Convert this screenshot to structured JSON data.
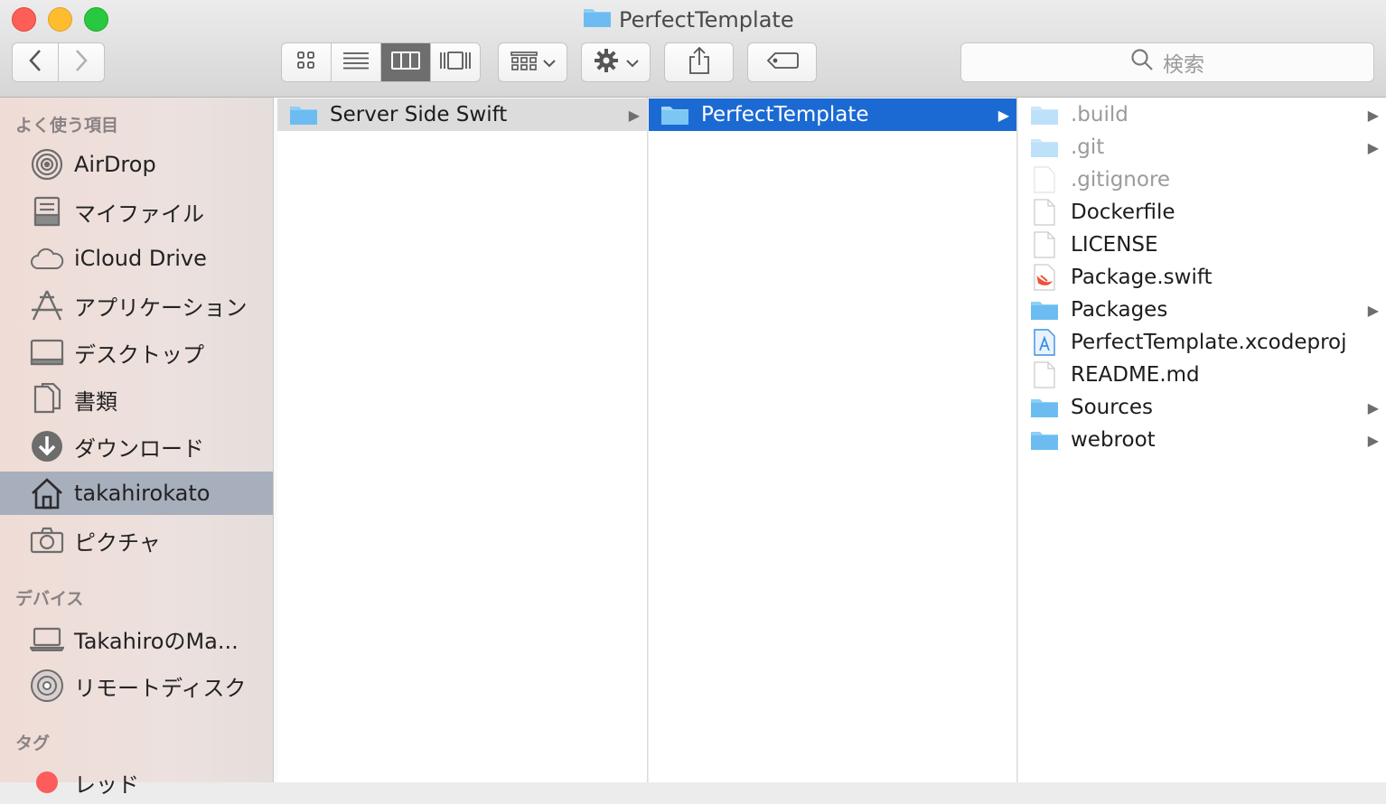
{
  "window": {
    "title": "PerfectTemplate"
  },
  "toolbar": {
    "back_icon": "chevron-left-icon",
    "forward_icon": "chevron-right-icon",
    "view_modes": [
      "icon-view-icon",
      "list-view-icon",
      "column-view-icon",
      "gallery-view-icon"
    ],
    "active_view": "column",
    "arrange_icon": "arrange-icon",
    "action_icon": "gear-icon",
    "share_icon": "share-icon",
    "tag_icon": "tag-icon",
    "search_placeholder": "検索"
  },
  "sidebar": {
    "favorites_header": "よく使う項目",
    "favorites": [
      {
        "label": "AirDrop",
        "icon": "airdrop-icon"
      },
      {
        "label": "マイファイル",
        "icon": "all-files-icon"
      },
      {
        "label": "iCloud Drive",
        "icon": "cloud-icon"
      },
      {
        "label": "アプリケーション",
        "icon": "applications-icon"
      },
      {
        "label": "デスクトップ",
        "icon": "desktop-icon"
      },
      {
        "label": "書類",
        "icon": "documents-icon"
      },
      {
        "label": "ダウンロード",
        "icon": "download-icon"
      },
      {
        "label": "takahirokato",
        "icon": "home-icon",
        "selected": true
      },
      {
        "label": "ピクチャ",
        "icon": "camera-icon"
      }
    ],
    "devices_header": "デバイス",
    "devices": [
      {
        "label": "TakahiroのMa...",
        "icon": "laptop-icon"
      },
      {
        "label": "リモートディスク",
        "icon": "disc-icon"
      }
    ],
    "tags_header": "タグ",
    "tags": [
      {
        "label": "レッド",
        "color": "#fc5c5c"
      }
    ]
  },
  "columns": {
    "col1": [
      {
        "name": "Server Side Swift",
        "kind": "folder",
        "has_children": true,
        "selected": "inactive"
      }
    ],
    "col2": [
      {
        "name": "PerfectTemplate",
        "kind": "folder",
        "has_children": true,
        "selected": "active"
      }
    ],
    "col3": [
      {
        "name": ".build",
        "kind": "folder-dim",
        "has_children": true,
        "hidden": true
      },
      {
        "name": ".git",
        "kind": "folder-dim",
        "has_children": true,
        "hidden": true
      },
      {
        "name": ".gitignore",
        "kind": "file-dim",
        "has_children": false,
        "hidden": true
      },
      {
        "name": "Dockerfile",
        "kind": "file",
        "has_children": false
      },
      {
        "name": "LICENSE",
        "kind": "file",
        "has_children": false
      },
      {
        "name": "Package.swift",
        "kind": "swift",
        "has_children": false
      },
      {
        "name": "Packages",
        "kind": "folder",
        "has_children": true
      },
      {
        "name": "PerfectTemplate.xcodeproj",
        "kind": "xcodeproj",
        "has_children": false
      },
      {
        "name": "README.md",
        "kind": "file",
        "has_children": false
      },
      {
        "name": "Sources",
        "kind": "folder",
        "has_children": true
      },
      {
        "name": "webroot",
        "kind": "folder",
        "has_children": true
      }
    ]
  },
  "colors": {
    "selection_blue": "#1b6ad3",
    "sidebar_selection": "#a7aebc",
    "folder_blue": "#6cbcf2"
  }
}
